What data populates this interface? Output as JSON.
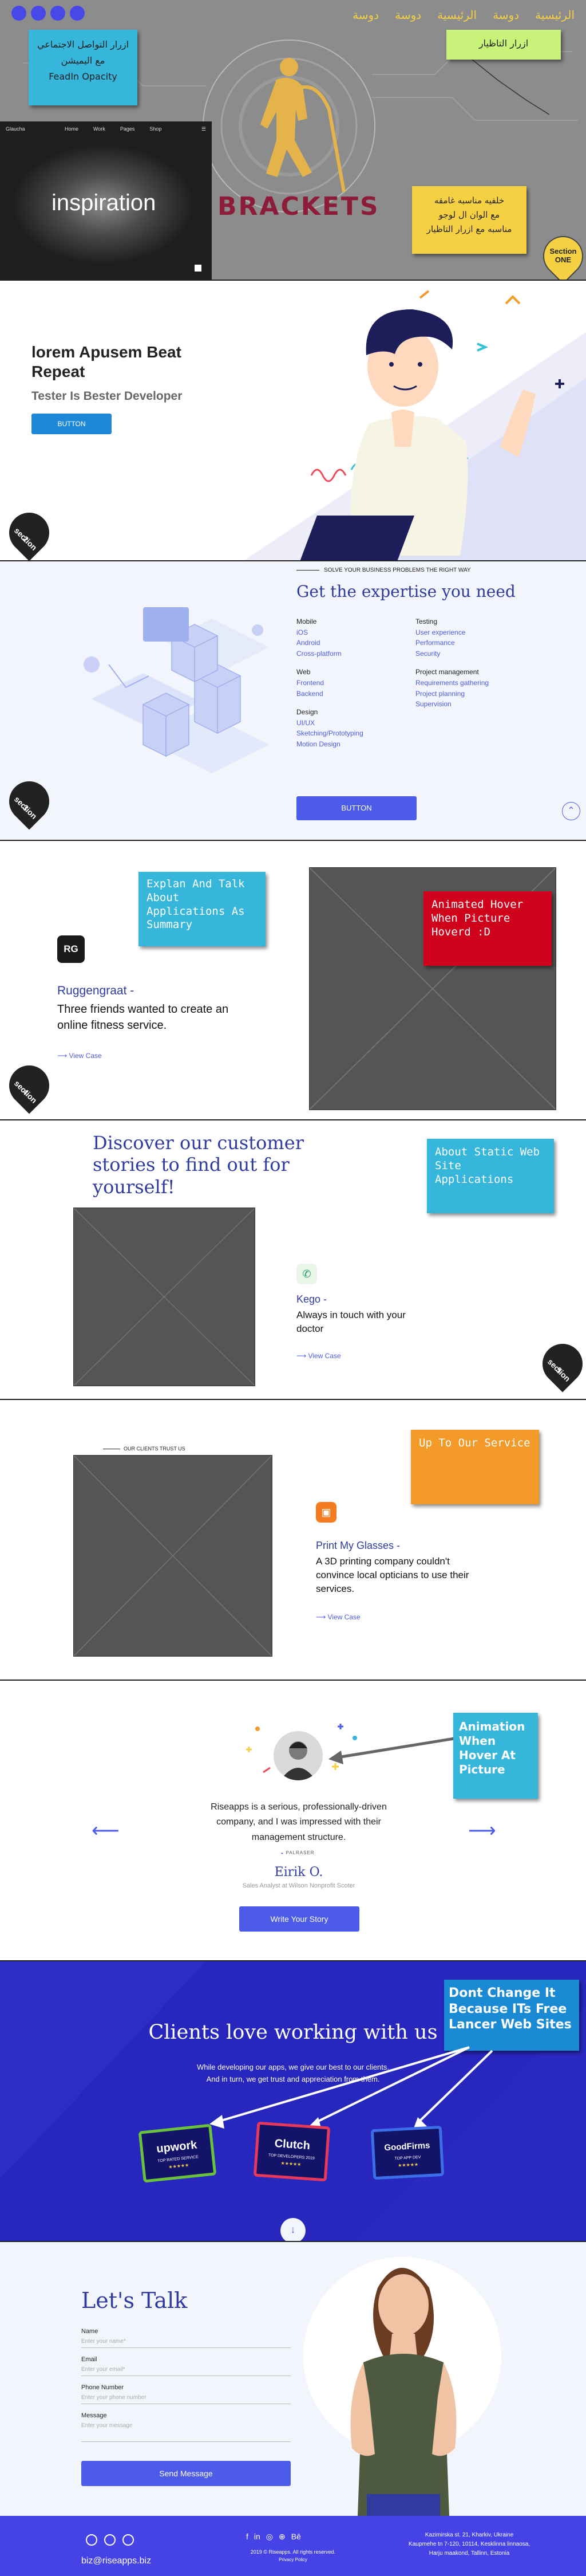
{
  "colors": {
    "accent": "#4c5be8",
    "hero_gray": "#8c8c8c",
    "brand_gold": "#e4b34a",
    "brand_red": "#8c1c3a",
    "note_blue": "#37b6dc",
    "note_green": "#c9f27a",
    "note_orange": "#f39a29",
    "note_red": "#d0021b",
    "note_yellow": "#f5d042",
    "blue_section": "#2727bd",
    "footer": "#4543e6"
  },
  "s1": {
    "nav": [
      "الرئيسية",
      "دوسة",
      "الرئيسية",
      "دوسة",
      "دوسة"
    ],
    "social_note": [
      "ازرار التواصل الاجتماعي",
      "مع اليميشن",
      "FeadIn Opacity"
    ],
    "hover_note": "ازرار التاظيار",
    "bg_note": [
      "خلفيه مناسبه غامقه",
      "مع الوان ال لوجو",
      "مناسبه مع ازرار التاظيار"
    ],
    "brand": "BRACKETS",
    "preview_logo": "Glaucha",
    "preview_word": "inspiration",
    "preview_menu": [
      "Home",
      "Work",
      "Pages",
      "Shop"
    ],
    "pin": [
      "Section",
      "ONE"
    ]
  },
  "s2": {
    "title": "lorem Apusem Beat Repeat",
    "subtitle": "Tester Is Bester Developer",
    "button": "BUTTON",
    "pin": [
      "section",
      "2"
    ]
  },
  "s3": {
    "tagline": "SOLVE YOUR BUSINESS PROBLEMS THE RIGHT WAY",
    "title": "Get the expertise you need",
    "col1": [
      {
        "head": "Mobile",
        "items": [
          "iOS",
          "Android",
          "Cross-platform"
        ]
      },
      {
        "head": "Web",
        "items": [
          "Frontend",
          "Backend"
        ]
      },
      {
        "head": "Design",
        "items": [
          "UI/UX",
          "Sketching/Prototyping",
          "Motion Design"
        ]
      }
    ],
    "col2": [
      {
        "head": "Testing",
        "items": [
          "User experience",
          "Performance",
          "Security"
        ]
      },
      {
        "head": "Project management",
        "items": [
          "Requirements gathering",
          "Project planning",
          "Supervision"
        ]
      }
    ],
    "button": "BUTTON",
    "up_icon": "chevron-up-icon",
    "pin": [
      "section",
      "3"
    ]
  },
  "s4": {
    "note": "Explan And Talk About Applications As Summary",
    "hover_note": "Animated Hover When Picture Hoverd :D",
    "logo": "RG",
    "company": "Ruggengraat -",
    "desc": "Three friends wanted to create an online fitness service.",
    "view": "View Case",
    "pin": [
      "section",
      "4"
    ]
  },
  "s5": {
    "title": "Discover our customer stories to find out for yourself!",
    "note": "About Static Web Site Applications",
    "company": "Kego -",
    "desc": "Always in touch with your doctor",
    "view": "View Case",
    "pin": [
      "section",
      "5"
    ]
  },
  "s6": {
    "tag": "OUR CLIENTS TRUST US",
    "note": "Up To Our Service",
    "company": "Print My Glasses -",
    "desc": "A 3D printing company couldn't convince local opticians to use their services.",
    "view": "View Case"
  },
  "s7": {
    "note": "Animation When Hover At Picture",
    "quote": "Riseapps is a serious, professionally-driven company, and I was impressed with their management structure.",
    "brand": "PALRASER",
    "name": "Eirik O.",
    "role": "Sales Analyst at Wilson Nonprofit Scoter",
    "button": "Write Your Story"
  },
  "s8": {
    "title": "Clients love working with us",
    "text": [
      "While developing our apps, we give our best to our clients.",
      "And in turn, we get trust and appreciation from them."
    ],
    "note": "Dont Change It Because ITs Free Lancer Web Sites",
    "badges": [
      {
        "name": "upwork",
        "sub": "TOP RATED SERVICE"
      },
      {
        "name": "Clutch",
        "sub": "TOP DEVELOPERS 2019"
      },
      {
        "name": "GoodFirms",
        "sub": "TOP APP DEV"
      }
    ],
    "down_icon": "arrow-down-icon"
  },
  "s9": {
    "title": "Let's Talk",
    "fields": [
      {
        "label": "Name",
        "placeholder": "Enter your name*"
      },
      {
        "label": "Email",
        "placeholder": "Enter your email*"
      },
      {
        "label": "Phone Number",
        "placeholder": "Enter your phone number"
      },
      {
        "label": "Message",
        "placeholder": "Enter your message"
      }
    ],
    "button": "Send Message"
  },
  "footer": {
    "email": "biz@riseapps.biz",
    "copyright": "2019 © Riseapps. All rights reserved.",
    "privacy": "Privacy Policy",
    "address": [
      "Kazimirska st. 21, Kharkiv, Ukraine",
      "Kaupmehe tn 7-120, 10114, Kesklinna linnaosa,",
      "Harju maakond, Tallinn, Estonia"
    ]
  }
}
